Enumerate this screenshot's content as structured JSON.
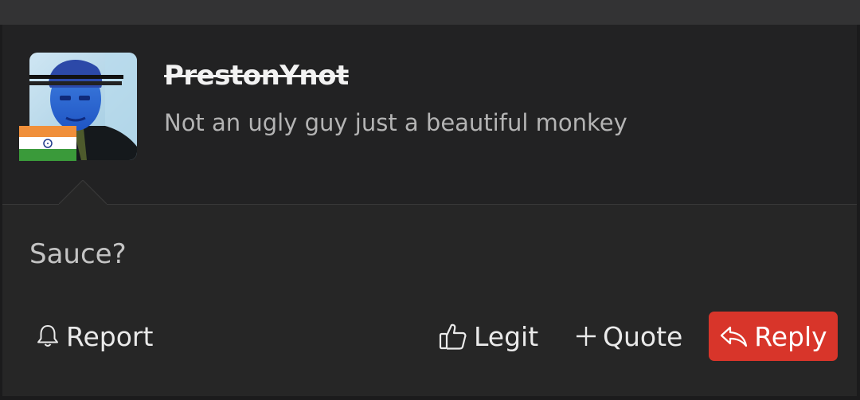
{
  "colors": {
    "page_bg": "#1b1b1c",
    "post_bg": "#262626",
    "header_bg": "#222223",
    "reply_button": "#d8352a",
    "text_primary": "#f2f2f2",
    "text_secondary": "#b4b4b4"
  },
  "post": {
    "author": {
      "username": "PrestonYnot",
      "username_struck_through": true,
      "subtitle": "Not an ugly guy just a beautiful monkey",
      "avatar": "avatar-photo",
      "flag": "india-flag"
    },
    "message": "Sauce?"
  },
  "actions": {
    "report": {
      "label": "Report",
      "icon": "bell-icon"
    },
    "legit": {
      "label": "Legit",
      "icon": "thumbs-up-icon"
    },
    "quote": {
      "label": "Quote",
      "icon": "plus-icon"
    },
    "reply": {
      "label": "Reply",
      "icon": "reply-arrow-icon"
    }
  }
}
